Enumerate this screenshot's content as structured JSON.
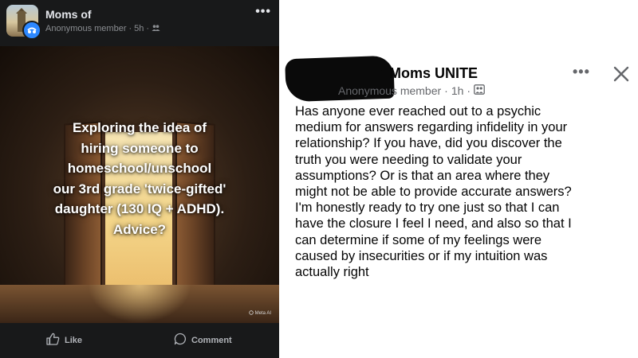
{
  "left_post": {
    "group_name": "Moms of",
    "author": "Anonymous member",
    "time": "5h",
    "separator": "·",
    "more_icon": "more-horizontal-icon",
    "privacy_icon": "members-icon",
    "image_text": "Exploring the idea of\nhiring someone to\nhomeschool/unschool\nour 3rd grade 'twice-gifted'\ndaughter (130 IQ + ADHD).\nAdvice?",
    "watermark": "Meta AI",
    "actions": {
      "like_label": "Like",
      "comment_label": "Comment"
    },
    "colors": {
      "background": "#18191a",
      "text": "#e4e6eb",
      "muted": "#8a8d91",
      "badge": "#2d88ff"
    }
  },
  "right_post": {
    "group_name": "Moms UNITE",
    "author": "Anonymous member",
    "time": "1h",
    "separator": "·",
    "more_icon": "more-horizontal-icon",
    "close_icon": "close-icon",
    "privacy_icon": "members-icon",
    "body": "Has anyone ever reached out to a psychic\nmedium for answers regarding infidelity in your\nrelationship? If you have, did you discover the\ntruth you were needing to validate your\nassumptions? Or is that an area where they\nmight not be able to provide accurate answers?\nI'm honestly ready to try one just so that I can\nhave the closure I feel I need, and also so that I\ncan determine if some of my feelings were\ncaused by insecurities or if my intuition was\nactually right",
    "colors": {
      "background": "#ffffff",
      "text": "#050505",
      "muted": "#65676b"
    }
  }
}
